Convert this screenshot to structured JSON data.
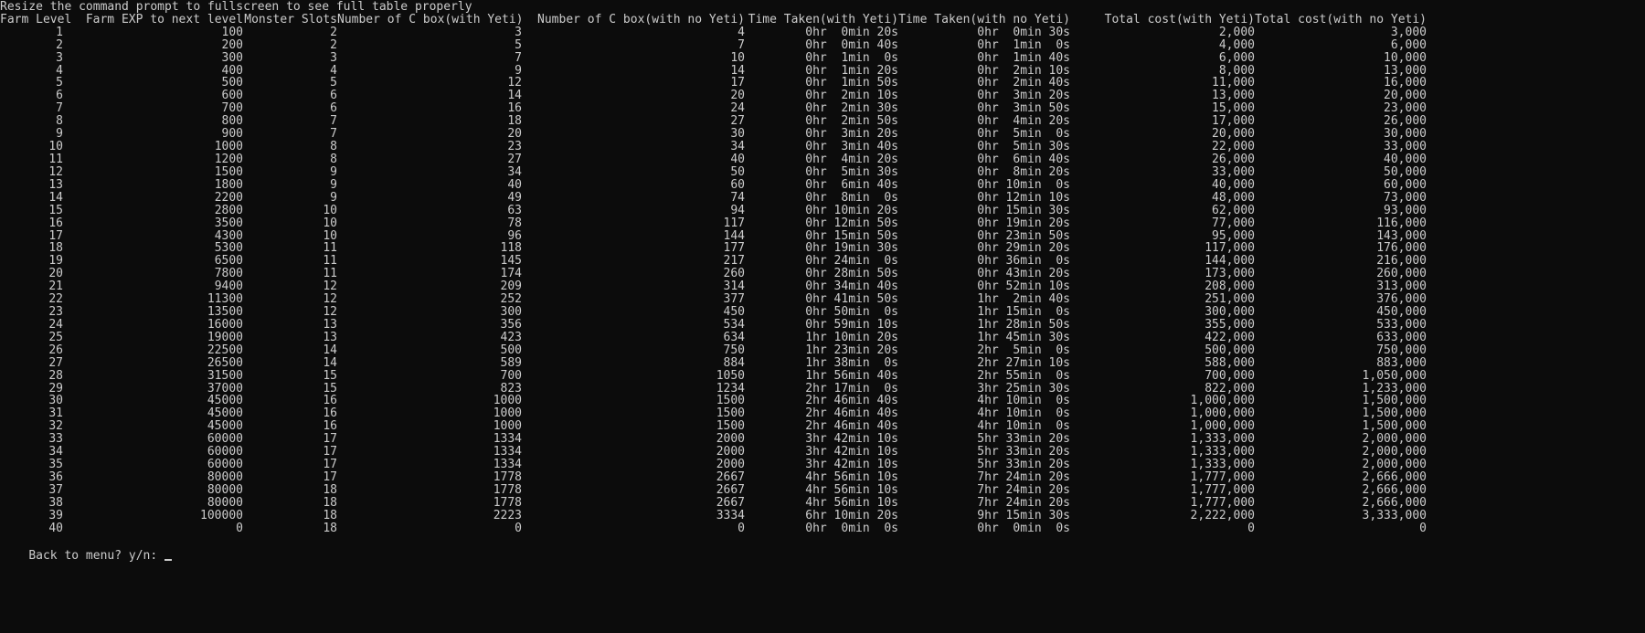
{
  "notice": "Resize the command prompt to fullscreen to see full table properly",
  "headers": [
    "Farm Level",
    "Farm EXP to next level",
    "Monster Slots",
    "Number of C box(with Yeti)",
    "Number of C box(with no Yeti)",
    "Time Taken(with Yeti)",
    "Time Taken(with no Yeti)",
    "Total cost(with Yeti)",
    "Total cost(with no Yeti)"
  ],
  "rows": [
    [
      "1",
      "100",
      "2",
      "3",
      "4",
      "0hr  0min 20s",
      "0hr  0min 30s",
      "2,000",
      "3,000"
    ],
    [
      "2",
      "200",
      "2",
      "5",
      "7",
      "0hr  0min 40s",
      "0hr  1min  0s",
      "4,000",
      "6,000"
    ],
    [
      "3",
      "300",
      "3",
      "7",
      "10",
      "0hr  1min  0s",
      "0hr  1min 40s",
      "6,000",
      "10,000"
    ],
    [
      "4",
      "400",
      "4",
      "9",
      "14",
      "0hr  1min 20s",
      "0hr  2min 10s",
      "8,000",
      "13,000"
    ],
    [
      "5",
      "500",
      "5",
      "12",
      "17",
      "0hr  1min 50s",
      "0hr  2min 40s",
      "11,000",
      "16,000"
    ],
    [
      "6",
      "600",
      "6",
      "14",
      "20",
      "0hr  2min 10s",
      "0hr  3min 20s",
      "13,000",
      "20,000"
    ],
    [
      "7",
      "700",
      "6",
      "16",
      "24",
      "0hr  2min 30s",
      "0hr  3min 50s",
      "15,000",
      "23,000"
    ],
    [
      "8",
      "800",
      "7",
      "18",
      "27",
      "0hr  2min 50s",
      "0hr  4min 20s",
      "17,000",
      "26,000"
    ],
    [
      "9",
      "900",
      "7",
      "20",
      "30",
      "0hr  3min 20s",
      "0hr  5min  0s",
      "20,000",
      "30,000"
    ],
    [
      "10",
      "1000",
      "8",
      "23",
      "34",
      "0hr  3min 40s",
      "0hr  5min 30s",
      "22,000",
      "33,000"
    ],
    [
      "11",
      "1200",
      "8",
      "27",
      "40",
      "0hr  4min 20s",
      "0hr  6min 40s",
      "26,000",
      "40,000"
    ],
    [
      "12",
      "1500",
      "9",
      "34",
      "50",
      "0hr  5min 30s",
      "0hr  8min 20s",
      "33,000",
      "50,000"
    ],
    [
      "13",
      "1800",
      "9",
      "40",
      "60",
      "0hr  6min 40s",
      "0hr 10min  0s",
      "40,000",
      "60,000"
    ],
    [
      "14",
      "2200",
      "9",
      "49",
      "74",
      "0hr  8min  0s",
      "0hr 12min 10s",
      "48,000",
      "73,000"
    ],
    [
      "15",
      "2800",
      "10",
      "63",
      "94",
      "0hr 10min 20s",
      "0hr 15min 30s",
      "62,000",
      "93,000"
    ],
    [
      "16",
      "3500",
      "10",
      "78",
      "117",
      "0hr 12min 50s",
      "0hr 19min 20s",
      "77,000",
      "116,000"
    ],
    [
      "17",
      "4300",
      "10",
      "96",
      "144",
      "0hr 15min 50s",
      "0hr 23min 50s",
      "95,000",
      "143,000"
    ],
    [
      "18",
      "5300",
      "11",
      "118",
      "177",
      "0hr 19min 30s",
      "0hr 29min 20s",
      "117,000",
      "176,000"
    ],
    [
      "19",
      "6500",
      "11",
      "145",
      "217",
      "0hr 24min  0s",
      "0hr 36min  0s",
      "144,000",
      "216,000"
    ],
    [
      "20",
      "7800",
      "11",
      "174",
      "260",
      "0hr 28min 50s",
      "0hr 43min 20s",
      "173,000",
      "260,000"
    ],
    [
      "21",
      "9400",
      "12",
      "209",
      "314",
      "0hr 34min 40s",
      "0hr 52min 10s",
      "208,000",
      "313,000"
    ],
    [
      "22",
      "11300",
      "12",
      "252",
      "377",
      "0hr 41min 50s",
      "1hr  2min 40s",
      "251,000",
      "376,000"
    ],
    [
      "23",
      "13500",
      "12",
      "300",
      "450",
      "0hr 50min  0s",
      "1hr 15min  0s",
      "300,000",
      "450,000"
    ],
    [
      "24",
      "16000",
      "13",
      "356",
      "534",
      "0hr 59min 10s",
      "1hr 28min 50s",
      "355,000",
      "533,000"
    ],
    [
      "25",
      "19000",
      "13",
      "423",
      "634",
      "1hr 10min 20s",
      "1hr 45min 30s",
      "422,000",
      "633,000"
    ],
    [
      "26",
      "22500",
      "14",
      "500",
      "750",
      "1hr 23min 20s",
      "2hr  5min  0s",
      "500,000",
      "750,000"
    ],
    [
      "27",
      "26500",
      "14",
      "589",
      "884",
      "1hr 38min  0s",
      "2hr 27min 10s",
      "588,000",
      "883,000"
    ],
    [
      "28",
      "31500",
      "15",
      "700",
      "1050",
      "1hr 56min 40s",
      "2hr 55min  0s",
      "700,000",
      "1,050,000"
    ],
    [
      "29",
      "37000",
      "15",
      "823",
      "1234",
      "2hr 17min  0s",
      "3hr 25min 30s",
      "822,000",
      "1,233,000"
    ],
    [
      "30",
      "45000",
      "16",
      "1000",
      "1500",
      "2hr 46min 40s",
      "4hr 10min  0s",
      "1,000,000",
      "1,500,000"
    ],
    [
      "31",
      "45000",
      "16",
      "1000",
      "1500",
      "2hr 46min 40s",
      "4hr 10min  0s",
      "1,000,000",
      "1,500,000"
    ],
    [
      "32",
      "45000",
      "16",
      "1000",
      "1500",
      "2hr 46min 40s",
      "4hr 10min  0s",
      "1,000,000",
      "1,500,000"
    ],
    [
      "33",
      "60000",
      "17",
      "1334",
      "2000",
      "3hr 42min 10s",
      "5hr 33min 20s",
      "1,333,000",
      "2,000,000"
    ],
    [
      "34",
      "60000",
      "17",
      "1334",
      "2000",
      "3hr 42min 10s",
      "5hr 33min 20s",
      "1,333,000",
      "2,000,000"
    ],
    [
      "35",
      "60000",
      "17",
      "1334",
      "2000",
      "3hr 42min 10s",
      "5hr 33min 20s",
      "1,333,000",
      "2,000,000"
    ],
    [
      "36",
      "80000",
      "17",
      "1778",
      "2667",
      "4hr 56min 10s",
      "7hr 24min 20s",
      "1,777,000",
      "2,666,000"
    ],
    [
      "37",
      "80000",
      "18",
      "1778",
      "2667",
      "4hr 56min 10s",
      "7hr 24min 20s",
      "1,777,000",
      "2,666,000"
    ],
    [
      "38",
      "80000",
      "18",
      "1778",
      "2667",
      "4hr 56min 10s",
      "7hr 24min 20s",
      "1,777,000",
      "2,666,000"
    ],
    [
      "39",
      "100000",
      "18",
      "2223",
      "3334",
      "6hr 10min 20s",
      "9hr 15min 30s",
      "2,222,000",
      "3,333,000"
    ],
    [
      "40",
      "0",
      "18",
      "0",
      "0",
      "0hr  0min  0s",
      "0hr  0min  0s",
      "0",
      "0"
    ]
  ],
  "prompt": "Back to menu? y/n:",
  "colors": {
    "background": "#0c0c0c",
    "text": "#cccccc"
  }
}
